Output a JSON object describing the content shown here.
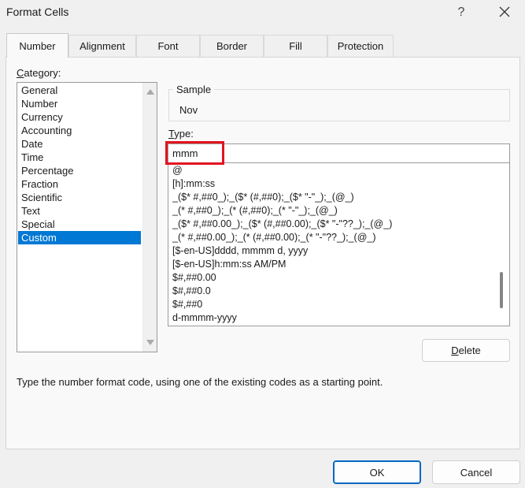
{
  "window": {
    "title": "Format Cells",
    "help_label": "?",
    "close_icon": "close-icon"
  },
  "tabs": [
    {
      "label": "Number",
      "active": true
    },
    {
      "label": "Alignment",
      "active": false
    },
    {
      "label": "Font",
      "active": false
    },
    {
      "label": "Border",
      "active": false
    },
    {
      "label": "Fill",
      "active": false
    },
    {
      "label": "Protection",
      "active": false
    }
  ],
  "category": {
    "label_prefix": "",
    "label_underlined": "C",
    "label_suffix": "ategory:",
    "items": [
      "General",
      "Number",
      "Currency",
      "Accounting",
      "Date",
      "Time",
      "Percentage",
      "Fraction",
      "Scientific",
      "Text",
      "Special",
      "Custom"
    ],
    "selected": "Custom"
  },
  "sample": {
    "label": "Sample",
    "value": "Nov"
  },
  "type": {
    "label_underlined": "T",
    "label_suffix": "ype:",
    "value": "mmm",
    "highlight_color": "#e3131f",
    "formats": [
      "@",
      "[h]:mm:ss",
      "_($* #,##0_);_($* (#,##0);_($* \"-\"_);_(@_)",
      "_(* #,##0_);_(* (#,##0);_(* \"-\"_);_(@_)",
      "_($* #,##0.00_);_($* (#,##0.00);_($* \"-\"??_);_(@_)",
      "_(* #,##0.00_);_(* (#,##0.00);_(* \"-\"??_);_(@_)",
      "[$-en-US]dddd, mmmm d, yyyy",
      "[$-en-US]h:mm:ss AM/PM",
      "$#,##0.00",
      "$#,##0.0",
      "$#,##0",
      "d-mmmm-yyyy"
    ]
  },
  "buttons": {
    "delete_underlined": "D",
    "delete_suffix": "elete",
    "ok": "OK",
    "cancel": "Cancel"
  },
  "hint": "Type the number format code, using one of the existing codes as a starting point.",
  "colors": {
    "selection": "#0078d4",
    "primary_border": "#0067c0",
    "background": "#f0f0f0"
  }
}
